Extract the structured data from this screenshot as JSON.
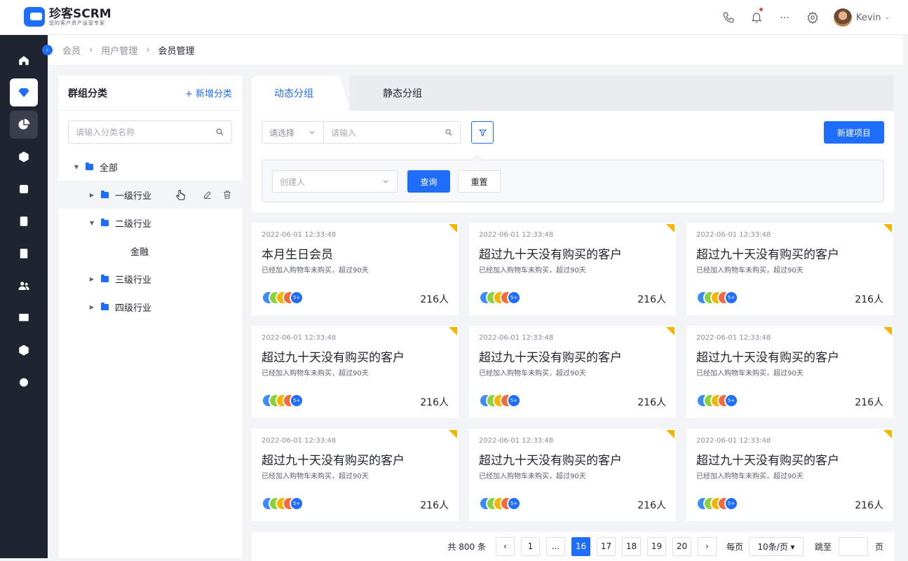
{
  "app": {
    "name": "珍客SCRM",
    "tagline": "您的客户资产运营专家"
  },
  "user": {
    "name": "Kevin"
  },
  "breadcrumb": [
    "会员",
    "用户管理",
    "会员管理"
  ],
  "left_panel": {
    "title": "群组分类",
    "add_label": "+ 新增分类",
    "search_placeholder": "请输入分类名称",
    "tree": [
      {
        "label": "全部",
        "level": 0,
        "expanded": true
      },
      {
        "label": "一级行业",
        "level": 1,
        "expanded": false,
        "highlighted": true
      },
      {
        "label": "二级行业",
        "level": 1,
        "expanded": true
      },
      {
        "label": "金融",
        "level": 2,
        "leaf": true
      },
      {
        "label": "三级行业",
        "level": 1,
        "expanded": false
      },
      {
        "label": "四级行业",
        "level": 1,
        "expanded": false
      }
    ]
  },
  "tabs": [
    {
      "label": "动态分组",
      "active": true
    },
    {
      "label": "静态分组",
      "active": false
    }
  ],
  "filters": {
    "select_placeholder": "请选择",
    "input_placeholder": "请输入",
    "creator_placeholder": "创建人",
    "query_label": "查询",
    "reset_label": "重置",
    "new_label": "新建项目"
  },
  "cards": [
    {
      "date": "2022-06-01 12:33:48",
      "title": "本月生日会员",
      "desc": "已经加入购物车未购买，超过90天",
      "count": "216人",
      "more": "5+"
    },
    {
      "date": "2022-06-01 12:33:48",
      "title": "超过九十天没有购买的客户",
      "desc": "已经加入购物车未购买，超过90天",
      "count": "216人",
      "more": "5+"
    },
    {
      "date": "2022-06-01 12:33:48",
      "title": "超过九十天没有购买的客户",
      "desc": "已经加入购物车未购买，超过90天",
      "count": "216人",
      "more": "5+"
    },
    {
      "date": "2022-06-01 12:33:48",
      "title": "超过九十天没有购买的客户",
      "desc": "已经加入购物车未购买，超过90天",
      "count": "216人",
      "more": "5+"
    },
    {
      "date": "2022-06-01 12:33:48",
      "title": "超过九十天没有购买的客户",
      "desc": "已经加入购物车未购买，超过90天",
      "count": "216人",
      "more": "5+"
    },
    {
      "date": "2022-06-01 12:33:48",
      "title": "超过九十天没有购买的客户",
      "desc": "已经加入购物车未购买，超过90天",
      "count": "216人",
      "more": "5+"
    },
    {
      "date": "2022-06-01 12:33:48",
      "title": "超过九十天没有购买的客户",
      "desc": "已经加入购物车未购买，超过90天",
      "count": "216人",
      "more": "5+"
    },
    {
      "date": "2022-06-01 12:33:48",
      "title": "超过九十天没有购买的客户",
      "desc": "已经加入购物车未购买，超过90天",
      "count": "216人",
      "more": "5+"
    },
    {
      "date": "2022-06-01 12:33:48",
      "title": "超过九十天没有购买的客户",
      "desc": "已经加入购物车未购买，超过90天",
      "count": "216人",
      "more": "5+"
    }
  ],
  "avatar_colors": [
    "#3b8bf5",
    "#8bd13a",
    "#f5b400",
    "#f36a3c"
  ],
  "pager": {
    "total": "共 800 条",
    "prev": "‹",
    "next": "›",
    "pages": [
      "1",
      "...",
      "16",
      "17",
      "18",
      "19",
      "20"
    ],
    "current": "16",
    "per_page_label": "每页",
    "page_size": "10条/页 ▾",
    "jump_label": "跳至",
    "page_suffix": "页"
  },
  "colors": {
    "primary": "#1e6dfb",
    "sidebar": "#202330",
    "accent_corner": "#f5b400"
  }
}
